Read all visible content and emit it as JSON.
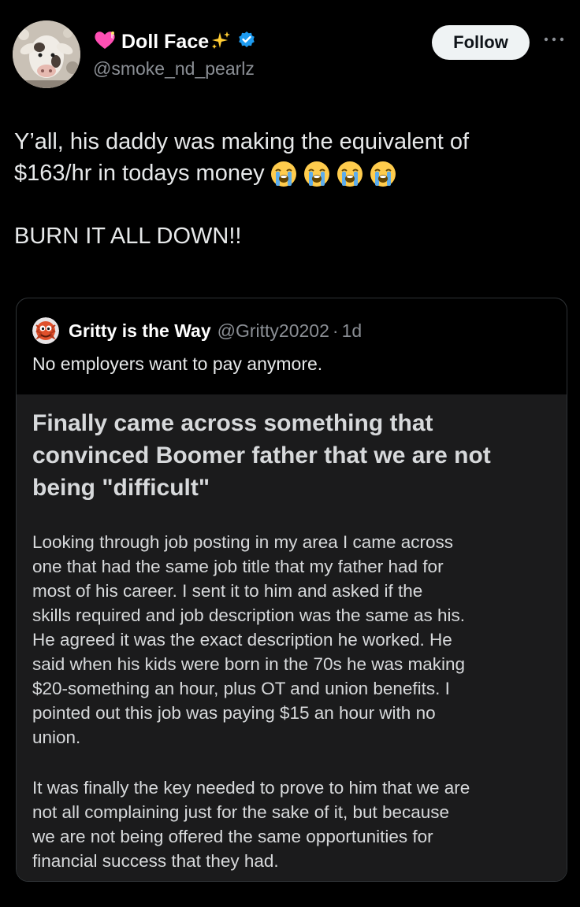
{
  "post": {
    "author": {
      "display_name": "Doll Face",
      "handle": "@smoke_nd_pearlz",
      "verified": true,
      "avatar_icon": "cow-avatar",
      "name_icons": [
        "heart-emoji",
        "sparkles-emoji",
        "verified-badge"
      ]
    },
    "follow_label": "Follow",
    "more_icon": "more-dots-icon",
    "text_line_1": "Y’all, his daddy was making the equivalent of",
    "text_line_2": "$163/hr in todays money",
    "text_emojis": [
      "loudly-crying-face",
      "loudly-crying-face",
      "loudly-crying-face",
      "loudly-crying-face"
    ],
    "text_line_3": "BURN IT ALL DOWN!!"
  },
  "quote": {
    "display_name": "Gritty is the Way",
    "handle": "@Gritty20202",
    "separator": "·",
    "time": "1d",
    "avatar_icon": "gritty-avatar",
    "text": "No employers want to pay anymore.",
    "image": {
      "title_lines": [
        "Finally came across something that",
        "convinced Boomer father that we are not",
        "being \"difficult\""
      ],
      "paragraph_1_lines": [
        "Looking through job posting in my area I came across",
        "one that had the same job title that my father had for",
        "most of his career.  I sent it to him and asked if the",
        "skills required and job description was the same as his.",
        "He agreed it was the exact description he worked. He",
        "said when his kids were born in the 70s he was making",
        "$20-something an hour, plus OT and union benefits. I",
        "pointed out this job was paying $15 an hour with no",
        "union."
      ],
      "paragraph_2_lines": [
        "It was finally the key needed to prove to him that we are",
        "not all complaining just for the sake of it, but because",
        "we are not being offered the same opportunities for",
        "financial success that they had."
      ]
    }
  },
  "colors": {
    "background": "#000000",
    "primary_text": "#e7e9ea",
    "secondary_text": "#8b8f95",
    "follow_button_bg": "#eff3f4",
    "verified_blue": "#1d9bf0",
    "card_border": "#2f3336",
    "image_bg": "#1b1b1c"
  }
}
